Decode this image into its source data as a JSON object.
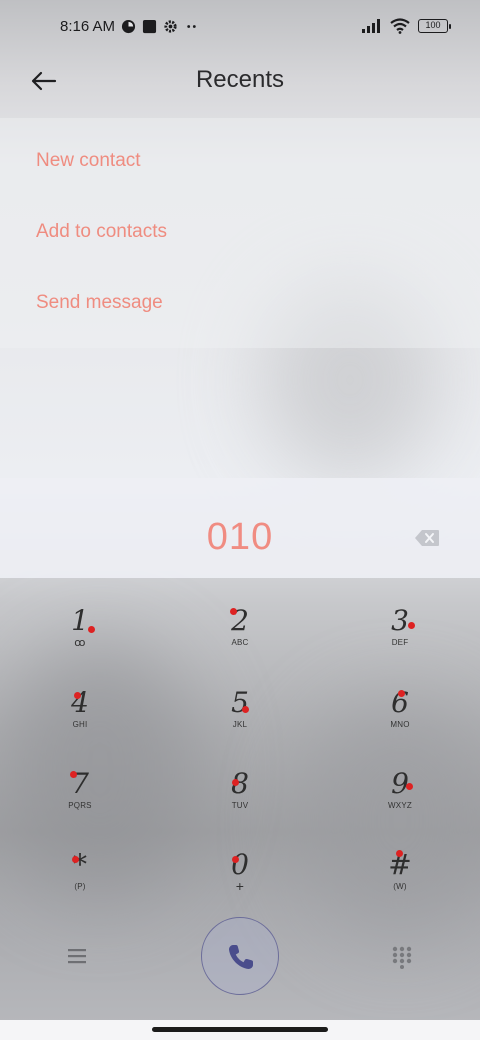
{
  "status_bar": {
    "time": "8:16 AM",
    "battery": "100",
    "icons": [
      "data-saver-icon",
      "square-notification-icon",
      "settings-gear-icon",
      "more-dots-icon",
      "signal-icon",
      "wifi-icon",
      "battery-icon"
    ]
  },
  "header": {
    "title": "Recents",
    "back_icon": "arrow-left-icon"
  },
  "menu": {
    "items": [
      {
        "label": "New contact"
      },
      {
        "label": "Add to contacts"
      },
      {
        "label": "Send message"
      }
    ]
  },
  "dialer": {
    "number": "010",
    "backspace_icon": "backspace-icon"
  },
  "keypad": {
    "keys": [
      {
        "digit": "1",
        "letters": "ꝏ"
      },
      {
        "digit": "2",
        "letters": "ABC"
      },
      {
        "digit": "3",
        "letters": "DEF"
      },
      {
        "digit": "4",
        "letters": "GHI"
      },
      {
        "digit": "5",
        "letters": "JKL"
      },
      {
        "digit": "6",
        "letters": "MNO"
      },
      {
        "digit": "7",
        "letters": "PQRS"
      },
      {
        "digit": "8",
        "letters": "TUV"
      },
      {
        "digit": "9",
        "letters": "WXYZ"
      },
      {
        "digit": "*",
        "letters": "(P)"
      },
      {
        "digit": "0",
        "letters": "+"
      },
      {
        "digit": "#",
        "letters": "(W)"
      }
    ]
  },
  "actions": {
    "menu_icon": "hamburger-menu-icon",
    "call_icon": "phone-icon",
    "dialpad_icon": "dialpad-grid-icon"
  },
  "colors": {
    "accent": "#ef8c80",
    "call_icon": "#4a4d8c",
    "text_dark": "#2b2b2d"
  }
}
